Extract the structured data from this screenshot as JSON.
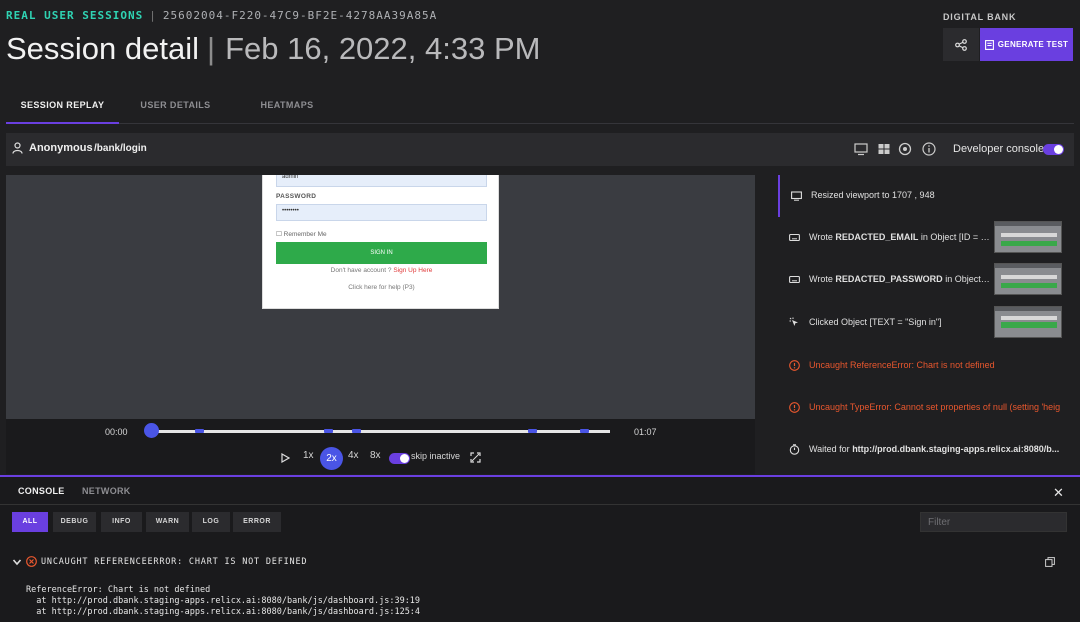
{
  "header": {
    "section": "REAL USER SESSIONS",
    "session_id": "25602004-F220-47C9-BF2E-4278AA39A85A",
    "title": "Session detail",
    "date": "Feb 16, 2022, 4:33 PM",
    "brand": "DIGITAL BANK",
    "generate_test_label": "GENERATE TEST"
  },
  "tabs": [
    "SESSION REPLAY",
    "USER DETAILS",
    "HEATMAPS"
  ],
  "session_bar": {
    "user": "Anonymous",
    "path": "/bank/login",
    "developer_console_label": "Developer console",
    "developer_console_on": true
  },
  "replay_frame": {
    "username_value": "admin",
    "password_label": "PASSWORD",
    "password_value": "••••••••",
    "remember_label": "Remember Me",
    "signin_label": "SIGN IN",
    "account_prompt": "Don't have account ?",
    "signup_link": "Sign Up Here",
    "help_text": "Click here for help (P3)"
  },
  "player": {
    "current_time": "00:00",
    "total_time": "01:07",
    "speeds": [
      "1x",
      "2x",
      "4x",
      "8x"
    ],
    "active_speed": "2x",
    "skip_inactive_label": "skip inactive",
    "skip_inactive_on": true
  },
  "events": [
    {
      "icon": "resize-icon",
      "text": "Resized viewport to 1707 , 948",
      "type": "info",
      "selected": true
    },
    {
      "icon": "keyboard-icon",
      "prefix": "Wrote ",
      "bold": "REDACTED_EMAIL",
      "suffix": " in Object [ID = \"...",
      "type": "info"
    },
    {
      "icon": "keyboard-icon",
      "prefix": "Wrote ",
      "bold": "REDACTED_PASSWORD",
      "suffix": " in Object [I...",
      "type": "info"
    },
    {
      "icon": "click-icon",
      "text": "Clicked Object [TEXT = \"Sign in\"]",
      "type": "info"
    },
    {
      "icon": "error-icon",
      "text": "Uncaught ReferenceError: Chart is not defined",
      "type": "error"
    },
    {
      "icon": "error-icon",
      "text": "Uncaught TypeError: Cannot set properties of null (setting 'heig",
      "type": "error"
    },
    {
      "icon": "timer-icon",
      "prefix": "Waited for ",
      "bold": "http://prod.dbank.staging-apps.relicx.ai:8080/b...",
      "suffix": "",
      "type": "info"
    }
  ],
  "console": {
    "tabs": [
      "CONSOLE",
      "NETWORK"
    ],
    "filters": [
      "ALL",
      "DEBUG",
      "INFO",
      "WARN",
      "LOG",
      "ERROR"
    ],
    "active_filter": "ALL",
    "filter_placeholder": "Filter",
    "error_title": "UNCAUGHT REFERENCEERROR: CHART IS NOT DEFINED",
    "trace_lines": [
      "ReferenceError: Chart is not defined",
      "  at http://prod.dbank.staging-apps.relicx.ai:8080/bank/js/dashboard.js:39:19",
      "  at http://prod.dbank.staging-apps.relicx.ai:8080/bank/js/dashboard.js:125:4"
    ]
  },
  "colors": {
    "accent": "#6a3fe0",
    "teal": "#2fd3b3",
    "error": "#e8572e",
    "player_blue": "#4a55e6"
  }
}
